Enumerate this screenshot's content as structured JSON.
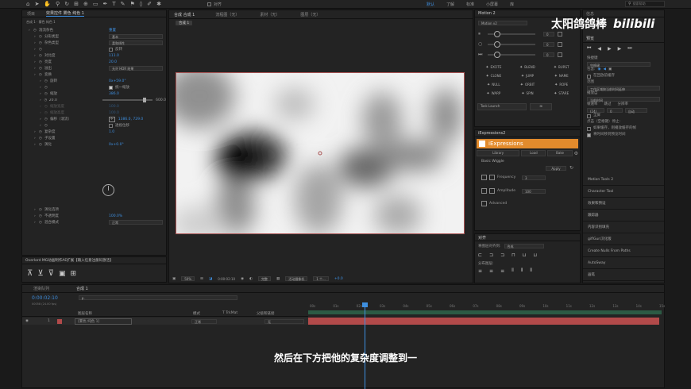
{
  "toolbar": {
    "align_label": "对齐",
    "workspaces": [
      "默认",
      "了解",
      "标准",
      "小屏幕",
      "库"
    ],
    "search_placeholder": "搜索帮助",
    "watermark": "太阳鸽鸽棒",
    "logo": "bilibili"
  },
  "effects_panel": {
    "tabs": [
      "项目",
      "效果控件 雾色 纯色 1"
    ],
    "breadcrumb": "合成 1 · 雾色 纯色 1",
    "rows": [
      {
        "label": "湍流杂色",
        "value": "重置",
        "indent": 0
      },
      {
        "label": "分形类型",
        "value": "基本",
        "indent": 1,
        "type": "select"
      },
      {
        "label": "杂色类型",
        "value": "柔和线性",
        "indent": 1,
        "type": "select"
      },
      {
        "label": "",
        "value": "反转",
        "indent": 1,
        "type": "check"
      },
      {
        "label": "对比度",
        "value": "111.0",
        "indent": 1
      },
      {
        "label": "亮度",
        "value": "20.0",
        "indent": 1
      },
      {
        "label": "溢出",
        "value": "允许 HDR 结果",
        "indent": 1,
        "type": "select"
      },
      {
        "label": "变换",
        "value": "",
        "indent": 1
      },
      {
        "label": "旋转",
        "value": "0x+59.0°",
        "indent": 2
      },
      {
        "label": "",
        "value": "统一缩放",
        "indent": 2,
        "type": "check"
      },
      {
        "label": "缩放",
        "value": "386.0",
        "indent": 2
      },
      {
        "label": "20.0",
        "value": "600.0",
        "indent": 2,
        "type": "slider"
      },
      {
        "label": "缩放宽度",
        "value": "100.0",
        "indent": 2,
        "dim": true
      },
      {
        "label": "缩放高度",
        "value": "100.0",
        "indent": 2,
        "dim": true
      },
      {
        "label": "偏移（湍流）",
        "value": "1386.0, 729.0",
        "indent": 2,
        "type": "point"
      },
      {
        "label": "",
        "value": "透视位移",
        "indent": 2,
        "type": "check"
      },
      {
        "label": "复杂度",
        "value": "1.0",
        "indent": 1
      },
      {
        "label": "子设置",
        "value": "",
        "indent": 1
      },
      {
        "label": "演化",
        "value": "0x+0.0°",
        "indent": 1
      }
    ],
    "rows2": [
      {
        "label": "演化选项",
        "value": "",
        "indent": 1
      },
      {
        "label": "不透明度",
        "value": "100.0%",
        "indent": 1
      },
      {
        "label": "混合模式",
        "value": "正常",
        "indent": 1,
        "type": "select"
      }
    ]
  },
  "plugin_bar": {
    "title": "Overlord MG动画制作AE扩展【输入任意注册码激活】"
  },
  "comp_panel": {
    "tabs": [
      "合成 合成 1",
      "流程图（无）",
      "素材（无）",
      "图层（无）"
    ],
    "subtab": "合成 1",
    "zoom": "50%",
    "timecode": "0:00:02:10",
    "quality": "完整",
    "camera": "活动摄像机",
    "views": "1 个...",
    "exposure": "+0.0"
  },
  "motion_panel": {
    "title": "Motion 2",
    "preset": "Motion v2",
    "sliders": [
      {
        "value": "0",
        "level": 0.2
      },
      {
        "value": "0",
        "level": 0.2
      },
      {
        "value": "0",
        "level": 0.2
      }
    ],
    "buttons": [
      "EXCITE",
      "BLEND",
      "BURST",
      "CLONE",
      "JUMP",
      "NAME",
      "NULL",
      "ORBIT",
      "ROPE",
      "WARP",
      "SPIN",
      "STARE"
    ],
    "task": "Task Launch"
  },
  "iexp_panel": {
    "tab": "iExpressions2",
    "title": "iExpressions",
    "menu": [
      "Library",
      "Load",
      "Bake"
    ],
    "section": "Basic Wiggle",
    "apply": "Apply",
    "frequency_label": "Frequency",
    "frequency_value": "3",
    "amplitude_label": "Amplitude",
    "amplitude_value": "100",
    "advanced": "Advanced"
  },
  "align_panel": {
    "title": "对齐",
    "align_to_label": "将图层对齐到:",
    "align_to_value": "合成",
    "distribute_label": "分布图层:"
  },
  "right_panel": {
    "tabs": [
      "信息",
      "音频"
    ],
    "preview_title": "预览",
    "shortcut_label": "快捷键",
    "shortcut_value": "空格键",
    "include_label": "包含:",
    "cache_label": "在回放前缓存",
    "range_label": "范围",
    "range_value": "工作区域按当前时间延伸",
    "play_label": "播放自",
    "play_value": "当前时间",
    "fps_label": "帧速率",
    "skip_label": "跳过",
    "res_label": "分辨率",
    "fps_value": "(24)",
    "skip_value": "0",
    "res_value": "自动",
    "fullscreen_label": "全屏",
    "stop_label": "点击（空格键）停止:",
    "cache_opt": "如果缓存，则播放缓存的帧",
    "move_opt": "将时间移到预览时间",
    "items": [
      "Motion Tools 2",
      "Character Tool",
      "效果和预设",
      "跟踪器",
      "内容识别填充",
      "giflGun汉化版",
      "Create Nulls From Paths",
      "AutoSway",
      "画笔"
    ]
  },
  "timeline": {
    "tabs": [
      "渲染队列",
      "合成 1"
    ],
    "timecode": "0:00:02:10",
    "frames": "00058 (24.00 fps)",
    "search_placeholder": "ρ.",
    "columns": [
      "图层名称",
      "模式",
      "T TrkMat",
      "父级和链接"
    ],
    "layer": {
      "index": "1",
      "name": "[雾色 纯色 1]",
      "mode": "正常",
      "parent": "无"
    },
    "ruler": [
      "00s",
      "01s",
      "02s",
      "03s",
      "04s",
      "05s",
      "06s",
      "07s",
      "08s",
      "09s",
      "10s",
      "11s",
      "12s",
      "13s",
      "14s",
      "15s"
    ],
    "playhead_fraction": 0.16
  },
  "subtitle": "然后在下方把他的复杂度调整到一",
  "colors": {
    "accent": "#3e8fe0",
    "layer_red": "#b24a4a",
    "iexp_orange": "#e38b2c"
  }
}
